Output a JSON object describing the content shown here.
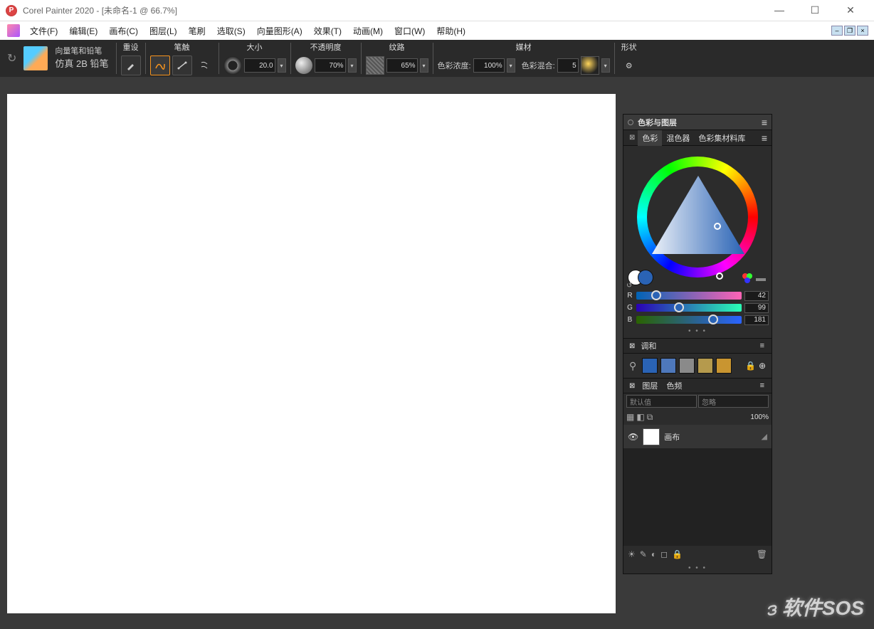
{
  "title": "Corel Painter 2020 - [未命名-1 @ 66.7%]",
  "menus": [
    "文件(F)",
    "编辑(E)",
    "画布(C)",
    "图层(L)",
    "笔刷",
    "选取(S)",
    "向量图形(A)",
    "效果(T)",
    "动画(M)",
    "窗口(W)",
    "帮助(H)"
  ],
  "brush": {
    "category": "向量笔和铅笔",
    "variant": "仿真 2B 铅笔"
  },
  "prop": {
    "reset": "重设",
    "dab": "笔触",
    "size": "大小",
    "size_val": "20.0",
    "opacity": "不透明度",
    "opacity_val": "70%",
    "grain": "纹路",
    "grain_val": "65%",
    "media": "媒材",
    "sat_label": "色彩浓度:",
    "sat_val": "100%",
    "blend_label": "色彩混合:",
    "blend_val": "5",
    "shape": "形状"
  },
  "panel": {
    "title": "色彩与图层",
    "color_tabs": [
      "色彩",
      "混色器",
      "色彩集材料库"
    ],
    "rgb": {
      "r": 42,
      "g": 99,
      "b": 181
    },
    "harmony_tab": "调和",
    "harmony_colors": [
      "#2a63b5",
      "#4e78bb",
      "#8a8a8a",
      "#b59a4d",
      "#c99530"
    ],
    "layer_tabs": [
      "图层",
      "色频"
    ],
    "blend_mode": "默认值",
    "blend_opt": "忽略",
    "opacity": "100%",
    "layer_name": "画布"
  },
  "watermark": "软件SOS"
}
